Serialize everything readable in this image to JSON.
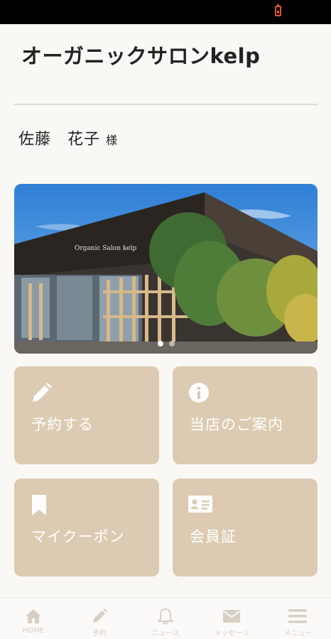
{
  "salon": {
    "title": "オーガニックサロンkelp"
  },
  "customer": {
    "name": "佐藤　花子",
    "suffix": "様"
  },
  "hero": {
    "sign_text": "Organic Salon kelp",
    "active_slide": 0,
    "slide_count": 2
  },
  "tiles": [
    {
      "label": "予約する",
      "icon": "pencil-icon"
    },
    {
      "label": "当店のご案内",
      "icon": "info-icon"
    },
    {
      "label": "マイクーポン",
      "icon": "bookmark-icon"
    },
    {
      "label": "会員証",
      "icon": "id-card-icon"
    }
  ],
  "nav": [
    {
      "label": "HOME",
      "icon": "home-icon"
    },
    {
      "label": "予約",
      "icon": "pencil-icon"
    },
    {
      "label": "ニュース",
      "icon": "bell-icon"
    },
    {
      "label": "メッセージ",
      "icon": "envelope-icon"
    },
    {
      "label": "メニュー",
      "icon": "hamburger-icon"
    }
  ],
  "colors": {
    "tile": "#dccbb2",
    "nav": "#d7cfc3",
    "battery": "#e0552e"
  }
}
